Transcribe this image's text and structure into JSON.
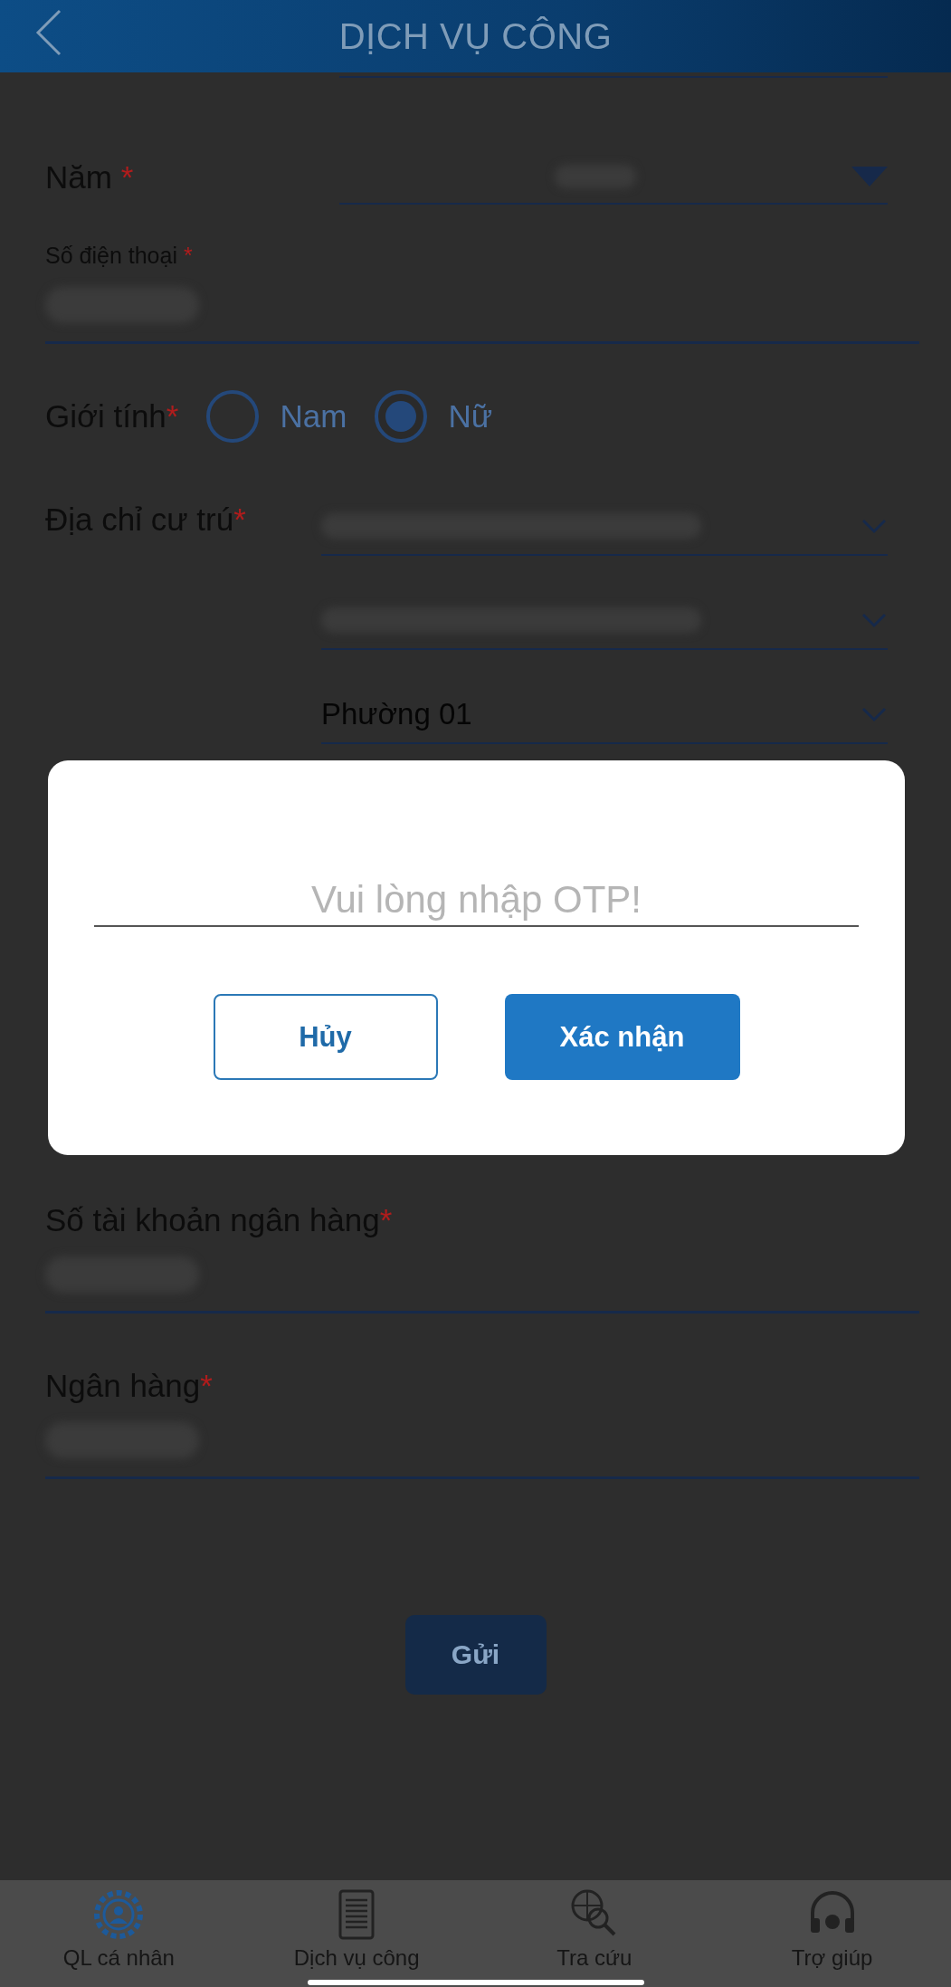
{
  "header": {
    "title": "DỊCH VỤ CÔNG"
  },
  "form": [
    {
      "kind": "dropdown",
      "label": "Năm",
      "required_mark": "*"
    },
    {
      "kind": "compact",
      "label": "Số điện thoại",
      "required_mark": "*"
    },
    {
      "kind": "radio",
      "label": "Giới tính",
      "required_mark": "*",
      "options": [
        {
          "label": "Nam",
          "selected": false
        },
        {
          "label": "Nữ",
          "selected": true
        }
      ]
    },
    {
      "kind": "address",
      "label": "Địa chỉ cư trú",
      "required_mark": "*",
      "selects": [
        {
          "kind": "blurred"
        },
        {
          "kind": "blurred"
        },
        {
          "kind": "value",
          "value": "Phường 01"
        }
      ]
    },
    {
      "kind": "text",
      "label": "Số tài khoản ngân hàng",
      "required_mark": "*"
    },
    {
      "kind": "text",
      "label": "Ngân hàng",
      "required_mark": "*"
    }
  ],
  "submit": {
    "label": "Gửi"
  },
  "dialog": {
    "placeholder": "Vui lòng nhập OTP!",
    "buttons": [
      {
        "label": "Hủy",
        "kind": "secondary"
      },
      {
        "label": "Xác nhận",
        "kind": "primary"
      }
    ]
  },
  "nav": [
    {
      "label": "QL cá nhân",
      "selected": true
    },
    {
      "label": "Dịch vụ công",
      "selected": false
    },
    {
      "label": "Tra cứu",
      "selected": false
    },
    {
      "label": "Trợ giúp",
      "selected": false
    }
  ]
}
